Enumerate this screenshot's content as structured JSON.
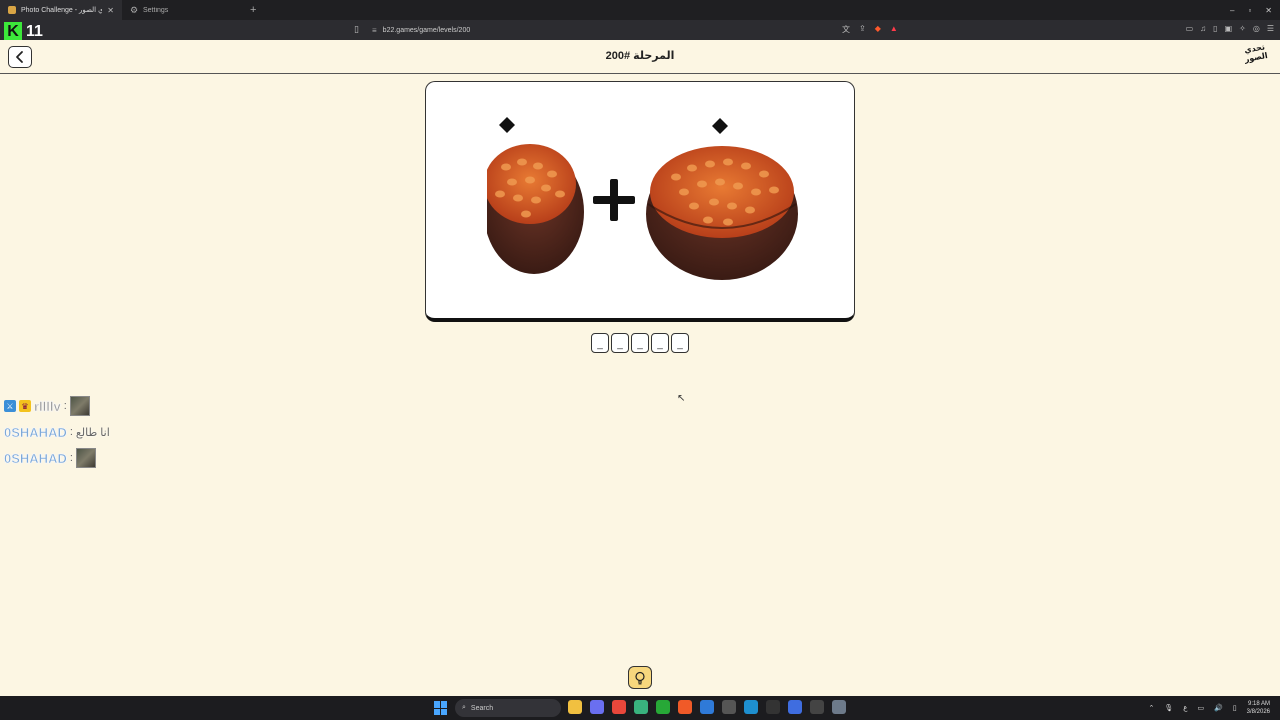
{
  "browser": {
    "tabs": [
      {
        "title": "Photo Challenge - تحدي الصور",
        "active": true
      },
      {
        "title": "Settings",
        "active": false
      }
    ],
    "new_tab_label": "+",
    "url": "b22.games/game/levels/200",
    "window_controls": [
      "–",
      "▫",
      "✕"
    ]
  },
  "overlay": {
    "counter_letter": "K",
    "counter_value": "11"
  },
  "header": {
    "title": "المرحلة #200",
    "logo_text": "تحدي الصور"
  },
  "puzzle": {
    "operator": "+",
    "image_items": [
      "beans-bowl-half-icon",
      "beans-bowl-icon"
    ],
    "marker_icon": "diamond-icon"
  },
  "answer": {
    "slots": [
      "_",
      "_",
      "_",
      "_",
      "_"
    ]
  },
  "chat": [
    {
      "user": "rllllv",
      "sep": ":",
      "message": "",
      "has_emote": true
    },
    {
      "user": "0SHAHAD",
      "sep": ":",
      "message": "انا طالع",
      "has_emote": false
    },
    {
      "user": "0SHAHAD",
      "sep": ":",
      "message": "",
      "has_emote": true
    }
  ],
  "hint": {
    "icon": "lightbulb-icon"
  },
  "taskbar": {
    "search_placeholder": "Search",
    "time": "9:18 AM",
    "date": "3/8/2026"
  },
  "colors": {
    "page_bg": "#fcf6e3",
    "accent_green": "#3ce83a",
    "hint_yellow": "#f7d77d"
  }
}
